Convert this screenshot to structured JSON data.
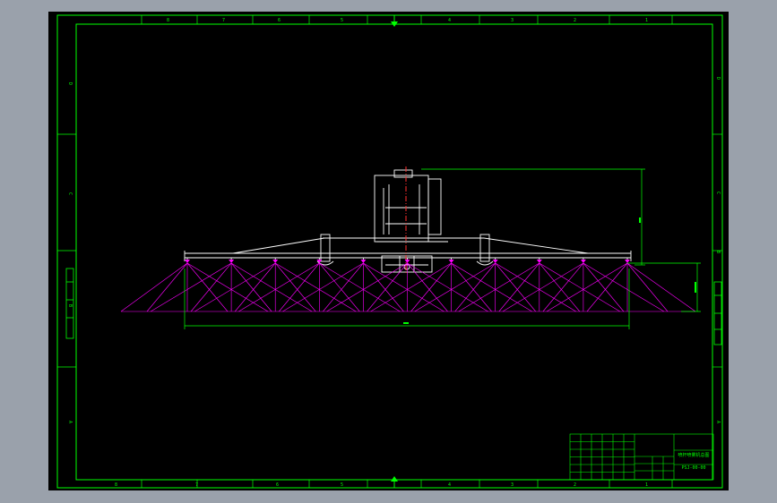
{
  "colors": {
    "viewport_background": "#9aa1ab",
    "sheet_background": "#000000",
    "frame": "#00ff00",
    "geometry": "#ffffff",
    "spray": "#ff00ff",
    "centerline": "#ff3030",
    "dimension": "#00ff00"
  },
  "border": {
    "top_zone_labels": [
      "8",
      "7",
      "6",
      "5",
      "4",
      "3",
      "2",
      "1"
    ],
    "bottom_zone_labels": [
      "8",
      "7",
      "6",
      "5",
      "4",
      "3",
      "2",
      "1"
    ],
    "left_zone_labels": [
      "D",
      "C",
      "B",
      "A"
    ],
    "right_zone_labels": [
      "D",
      "C",
      "B",
      "A"
    ]
  },
  "drawing": {
    "nozzle_count": 11,
    "nozzle_icon": "spray-nozzle-icon",
    "center_mark_icon": "center-triangle-icon"
  },
  "title_block": {
    "drawing_title": "喷杆喷雾机总图",
    "drawing_number": "PSJ-00-00"
  }
}
